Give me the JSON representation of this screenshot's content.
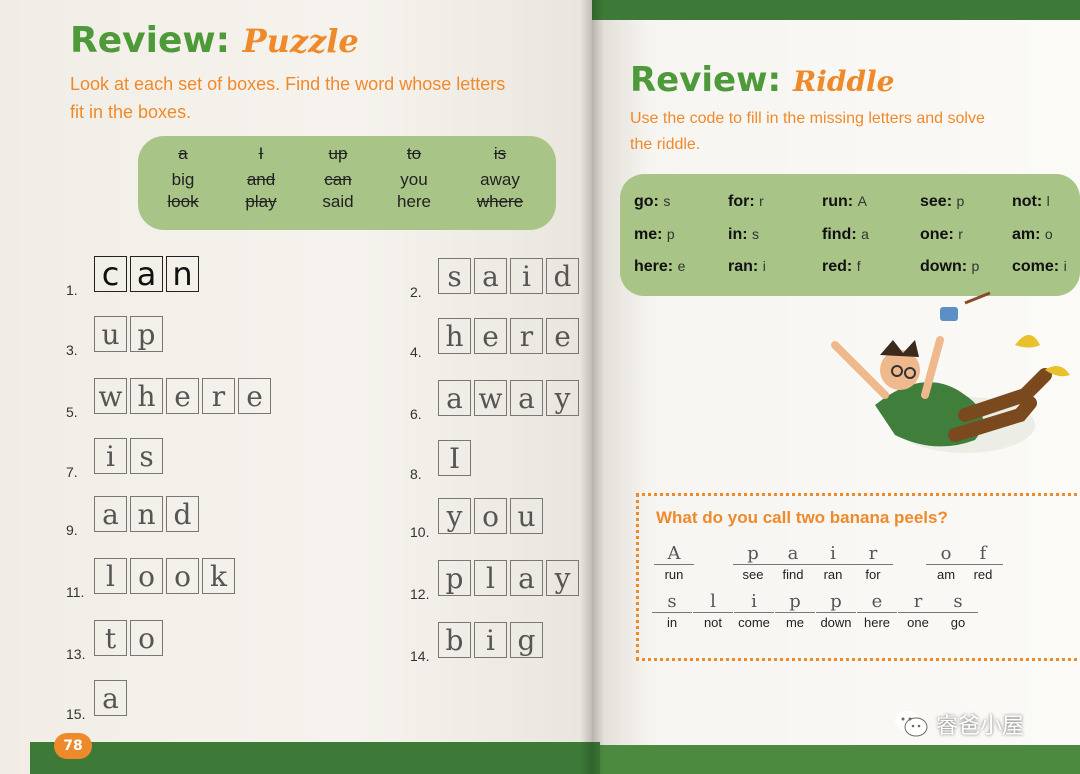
{
  "left_page": {
    "title": "Review:",
    "subtitle": "Puzzle",
    "instructions_line1": "Look at each set of boxes. Find the word whose letters",
    "instructions_line2": "fit in the boxes.",
    "word_bank": [
      {
        "word": "a",
        "crossed": true
      },
      {
        "word": "I",
        "crossed": true
      },
      {
        "word": "up",
        "crossed": true
      },
      {
        "word": "to",
        "crossed": true
      },
      {
        "word": "is",
        "crossed": true
      },
      {
        "word": "big",
        "crossed": false
      },
      {
        "word": "and",
        "crossed": true
      },
      {
        "word": "can",
        "crossed": true
      },
      {
        "word": "you",
        "crossed": false
      },
      {
        "word": "away",
        "crossed": false
      },
      {
        "word": "look",
        "crossed": true
      },
      {
        "word": "play",
        "crossed": true
      },
      {
        "word": "said",
        "crossed": false
      },
      {
        "word": "here",
        "crossed": false
      },
      {
        "word": "where",
        "crossed": true
      }
    ],
    "puzzles": [
      {
        "num": "1.",
        "letters": [
          "c",
          "a",
          "n"
        ]
      },
      {
        "num": "2.",
        "letters": [
          "s",
          "a",
          "i",
          "d"
        ]
      },
      {
        "num": "3.",
        "letters": [
          "u",
          "p"
        ]
      },
      {
        "num": "4.",
        "letters": [
          "h",
          "e",
          "r",
          "e"
        ]
      },
      {
        "num": "5.",
        "letters": [
          "w",
          "h",
          "e",
          "r",
          "e"
        ]
      },
      {
        "num": "6.",
        "letters": [
          "a",
          "w",
          "a",
          "y"
        ]
      },
      {
        "num": "7.",
        "letters": [
          "i",
          "s"
        ]
      },
      {
        "num": "8.",
        "letters": [
          "I"
        ]
      },
      {
        "num": "9.",
        "letters": [
          "a",
          "n",
          "d"
        ]
      },
      {
        "num": "10.",
        "letters": [
          "y",
          "o",
          "u"
        ]
      },
      {
        "num": "11.",
        "letters": [
          "l",
          "o",
          "o",
          "k"
        ]
      },
      {
        "num": "12.",
        "letters": [
          "p",
          "l",
          "a",
          "y"
        ]
      },
      {
        "num": "13.",
        "letters": [
          "t",
          "o"
        ]
      },
      {
        "num": "14.",
        "letters": [
          "b",
          "i",
          "g"
        ]
      },
      {
        "num": "15.",
        "letters": [
          "a"
        ]
      }
    ],
    "page_number": "78"
  },
  "right_page": {
    "title": "Review:",
    "subtitle": "Riddle",
    "instructions_line1": "Use the code to fill in the missing letters and solve",
    "instructions_line2": "the riddle.",
    "code": [
      {
        "word": "go:",
        "letter": "s"
      },
      {
        "word": "for:",
        "letter": "r"
      },
      {
        "word": "run:",
        "letter": "A"
      },
      {
        "word": "see:",
        "letter": "p"
      },
      {
        "word": "not:",
        "letter": "l"
      },
      {
        "word": "me:",
        "letter": "p"
      },
      {
        "word": "in:",
        "letter": "s"
      },
      {
        "word": "find:",
        "letter": "a"
      },
      {
        "word": "one:",
        "letter": "r"
      },
      {
        "word": "am:",
        "letter": "o"
      },
      {
        "word": "here:",
        "letter": "e"
      },
      {
        "word": "ran:",
        "letter": "i"
      },
      {
        "word": "red:",
        "letter": "f"
      },
      {
        "word": "down:",
        "letter": "p"
      },
      {
        "word": "come:",
        "letter": "i"
      }
    ],
    "riddle_question": "What do you call two banana peels?",
    "answer_row1": [
      {
        "ans": "A",
        "clue": "run"
      },
      {
        "ans": "p",
        "clue": "see"
      },
      {
        "ans": "a",
        "clue": "find"
      },
      {
        "ans": "i",
        "clue": "ran"
      },
      {
        "ans": "r",
        "clue": "for"
      },
      {
        "ans": "o",
        "clue": "am"
      },
      {
        "ans": "f",
        "clue": "red"
      }
    ],
    "answer_row2": [
      {
        "ans": "s",
        "clue": "in"
      },
      {
        "ans": "l",
        "clue": "not"
      },
      {
        "ans": "i",
        "clue": "come"
      },
      {
        "ans": "p",
        "clue": "me"
      },
      {
        "ans": "p",
        "clue": "down"
      },
      {
        "ans": "e",
        "clue": "here"
      },
      {
        "ans": "r",
        "clue": "one"
      },
      {
        "ans": "s",
        "clue": "go"
      }
    ]
  },
  "watermark": "睿爸小屋",
  "colors": {
    "green": "#4e9a3b",
    "orange": "#ef8a2b",
    "bank": "#a9c487"
  }
}
